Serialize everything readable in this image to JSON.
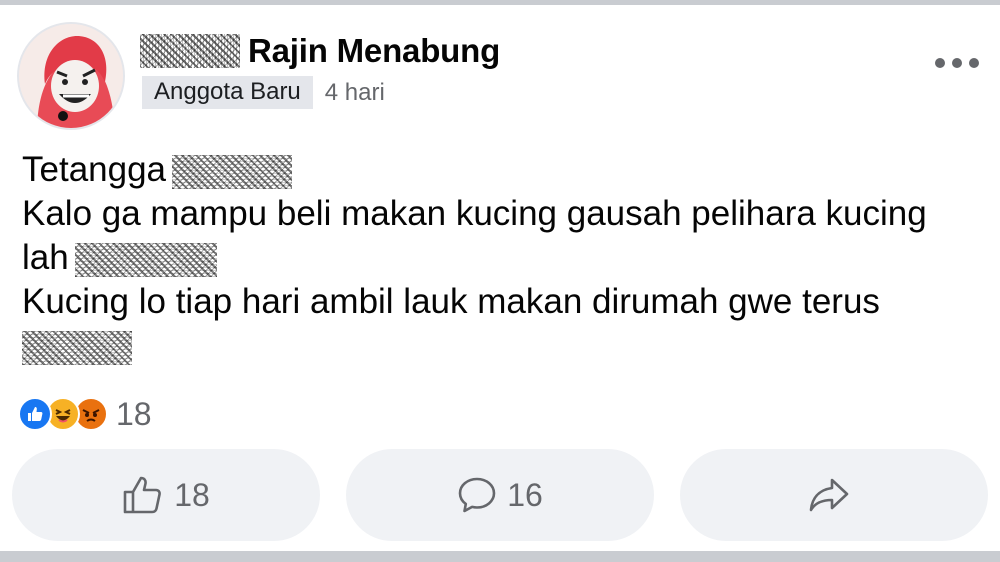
{
  "post": {
    "author": "Rajin Menabung",
    "badge": "Anggota Baru",
    "time": "4 hari",
    "lines": [
      "Tetangga",
      "Kalo ga mampu beli makan kucing gausah pelihara kucing",
      "lah",
      "Kucing lo tiap hari ambil lauk makan dirumah gwe terus"
    ]
  },
  "reactions": {
    "icons": [
      "like-icon",
      "haha-icon",
      "angry-icon"
    ],
    "count": "18"
  },
  "actions": {
    "like_count": "18",
    "comment_count": "16"
  },
  "colors": {
    "like_blue": "#1877f2",
    "haha_yellow": "#f7b125",
    "angry_orange": "#e9710f",
    "button_bg": "#f0f2f5",
    "secondary_text": "#65676b"
  }
}
